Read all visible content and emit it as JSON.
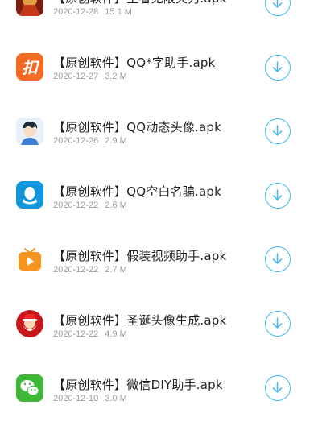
{
  "apps": [
    {
      "title": "【原创软件】王者无限火力.apk",
      "date": "2020-12-28",
      "size": "15.1 M",
      "icon": "game-hero-icon"
    },
    {
      "title": "【原创软件】QQ*字助手.apk",
      "date": "2020-12-27",
      "size": "3.2 M",
      "icon": "orange-k-icon"
    },
    {
      "title": "【原创软件】QQ动态头像.apk",
      "date": "2020-12-26",
      "size": "2.9 M",
      "icon": "cartoon-face-icon"
    },
    {
      "title": "【原创软件】QQ空白名骗.apk",
      "date": "2020-12-22",
      "size": "2.6 M",
      "icon": "qq-penguin-icon"
    },
    {
      "title": "【原创软件】假装视频助手.apk",
      "date": "2020-12-22",
      "size": "2.7 M",
      "icon": "tv-play-icon"
    },
    {
      "title": "【原创软件】圣诞头像生成.apk",
      "date": "2020-12-22",
      "size": "4.9 M",
      "icon": "santa-icon"
    },
    {
      "title": "【原创软件】微信DIY助手.apk",
      "date": "2020-12-10",
      "size": "3.0 M",
      "icon": "wechat-icon"
    }
  ],
  "colors": {
    "accent": "#3fb8ee",
    "title_text": "#1f1f1f",
    "meta_text": "#9a9a9a"
  }
}
